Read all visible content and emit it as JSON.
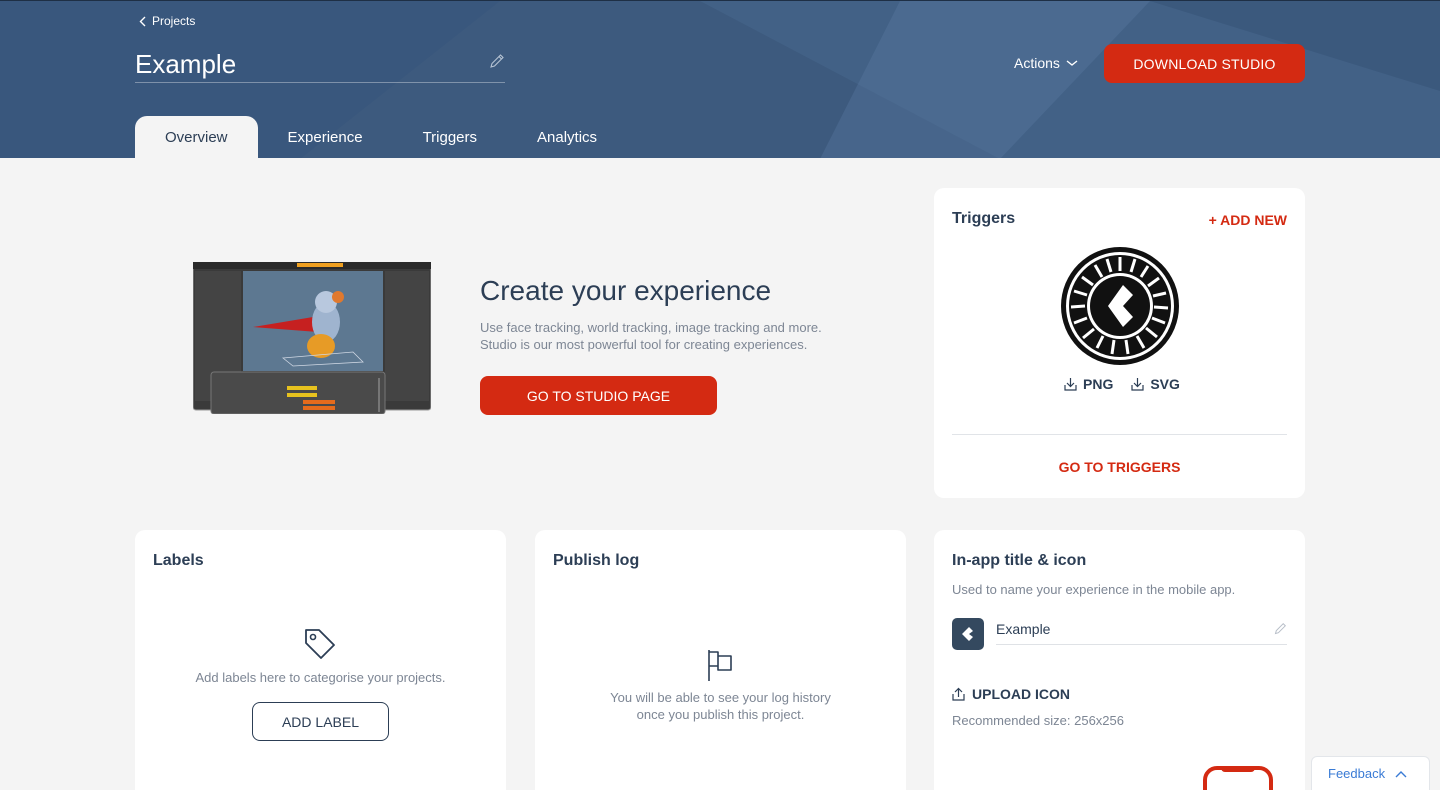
{
  "header": {
    "breadcrumb": "Projects",
    "project_title": "Example",
    "actions_label": "Actions",
    "download_button": "DOWNLOAD STUDIO"
  },
  "tabs": [
    {
      "label": "Overview",
      "active": true
    },
    {
      "label": "Experience",
      "active": false
    },
    {
      "label": "Triggers",
      "active": false
    },
    {
      "label": "Analytics",
      "active": false
    }
  ],
  "hero": {
    "title": "Create your experience",
    "description_line1": "Use face tracking, world tracking, image tracking and more.",
    "description_line2": "Studio is our most powerful tool for creating experiences.",
    "button": "GO TO STUDIO PAGE"
  },
  "triggers_card": {
    "title": "Triggers",
    "add_new": "+ ADD NEW",
    "download_png": "PNG",
    "download_svg": "SVG",
    "goto": "GO TO TRIGGERS"
  },
  "labels_card": {
    "title": "Labels",
    "empty_text": "Add labels here to categorise your projects.",
    "button": "ADD LABEL"
  },
  "publish_card": {
    "title": "Publish log",
    "empty_line1": "You will be able to see your log history",
    "empty_line2": "once you publish this project."
  },
  "inapp_card": {
    "title": "In-app title & icon",
    "subtitle": "Used to name your experience in the mobile app.",
    "app_name": "Example",
    "upload_label": "UPLOAD ICON",
    "recommended": "Recommended size: 256x256"
  },
  "feedback": "Feedback",
  "colors": {
    "brand_red": "#d42a12",
    "header_blue": "#3d5a7e",
    "text_dark": "#2c3e55",
    "link_blue": "#3a7bd5"
  }
}
